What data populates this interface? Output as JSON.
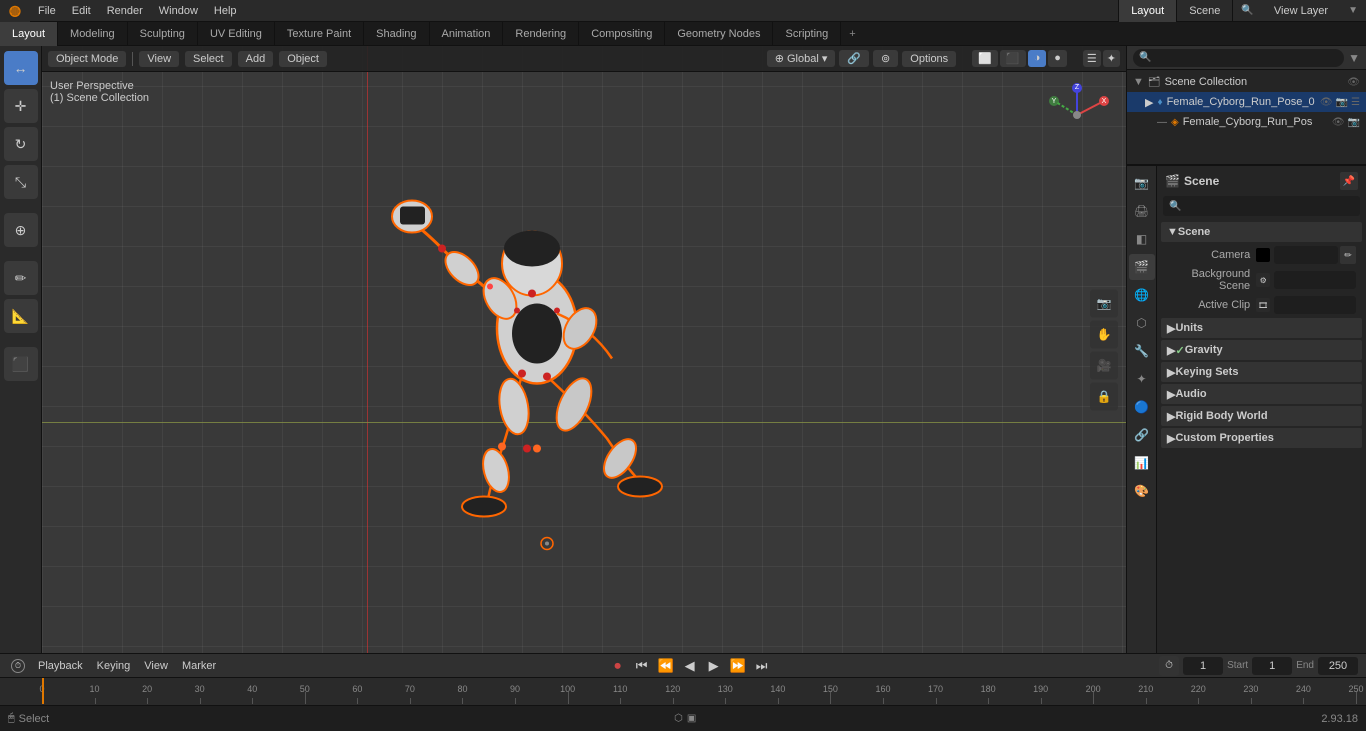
{
  "menubar": {
    "logo": "●",
    "items": [
      "File",
      "Edit",
      "Render",
      "Window",
      "Help"
    ]
  },
  "workspace_tabs": {
    "tabs": [
      "Layout",
      "Modeling",
      "Sculpting",
      "UV Editing",
      "Texture Paint",
      "Shading",
      "Animation",
      "Rendering",
      "Compositing",
      "Geometry Nodes",
      "Scripting"
    ],
    "active": "Layout"
  },
  "top_right": {
    "scene_name": "Scene",
    "view_layer": "View Layer"
  },
  "viewport": {
    "mode": "Object Mode",
    "view": "View",
    "select": "Select",
    "add": "Add",
    "object": "Object",
    "transform": "Global",
    "perspective_label": "User Perspective",
    "scene_collection": "(1) Scene Collection",
    "options_btn": "Options"
  },
  "outliner": {
    "title": "Scene Collection",
    "items": [
      {
        "name": "Female_Cyborg_Run_Pose_0",
        "level": 1,
        "has_arrow": true,
        "icon": "▶"
      },
      {
        "name": "Female_Cyborg_Run_Pos",
        "level": 2,
        "has_arrow": false,
        "icon": "🔷"
      }
    ]
  },
  "properties": {
    "active_tab": "scene",
    "title": "Scene",
    "tabs": [
      "render",
      "output",
      "view_layer",
      "scene",
      "world",
      "object",
      "modifier",
      "particles"
    ],
    "sections": {
      "scene": {
        "label": "Scene",
        "rows": [
          {
            "label": "Camera",
            "type": "value",
            "value": ""
          },
          {
            "label": "Background Scene",
            "type": "value",
            "value": ""
          },
          {
            "label": "Active Clip",
            "type": "value",
            "value": ""
          }
        ]
      },
      "units": {
        "label": "Units"
      },
      "gravity": {
        "label": "✓ Gravity"
      },
      "keying_sets": {
        "label": "Keying Sets"
      },
      "audio": {
        "label": "Audio"
      },
      "rigid_body_world": {
        "label": "Rigid Body World"
      },
      "custom_properties": {
        "label": "Custom Properties"
      }
    }
  },
  "timeline": {
    "playback_btn": "Playback",
    "keying_btn": "Keying",
    "view_btn": "View",
    "marker_btn": "Marker",
    "current_frame": "1",
    "start_label": "Start",
    "start_value": "1",
    "end_label": "End",
    "end_value": "250",
    "ruler_marks": [
      0,
      10,
      20,
      30,
      40,
      50,
      60,
      70,
      80,
      90,
      100,
      110,
      120,
      130,
      140,
      150,
      160,
      170,
      180,
      190,
      200,
      210,
      220,
      230,
      240,
      250
    ]
  },
  "status_bar": {
    "select_label": "Select",
    "version": "2.93.18"
  },
  "tools": {
    "left": [
      "↔",
      "↕",
      "⟳",
      "⌖",
      "✏",
      "▣",
      "◉",
      "⊙",
      "⬡",
      "✂"
    ],
    "right_viewport": [
      "📷",
      "✋",
      "🎥",
      "🔒"
    ]
  }
}
